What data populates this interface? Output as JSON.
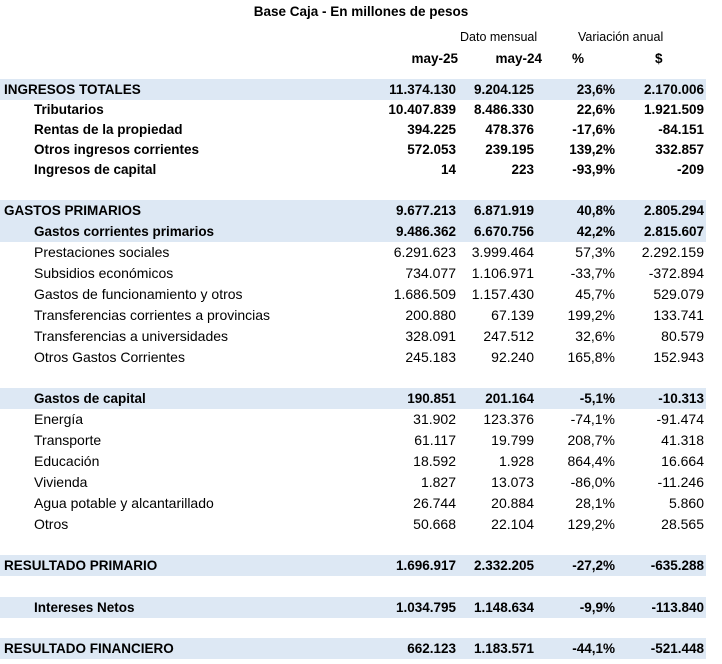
{
  "title": "Base Caja - En millones de pesos",
  "headers": {
    "group_left": "Dato mensual",
    "group_right": "Variación anual",
    "cols": [
      "may-25",
      "may-24",
      "%",
      "$"
    ]
  },
  "rows": [
    {
      "label": "INGRESOS TOTALES",
      "values": [
        "11.374.130",
        "9.204.125",
        "23,6%",
        "2.170.006"
      ]
    },
    {
      "label": "Tributarios",
      "values": [
        "10.407.839",
        "8.486.330",
        "22,6%",
        "1.921.509"
      ]
    },
    {
      "label": "Rentas de la propiedad",
      "values": [
        "394.225",
        "478.376",
        "-17,6%",
        "-84.151"
      ]
    },
    {
      "label": "Otros ingresos corrientes",
      "values": [
        "572.053",
        "239.195",
        "139,2%",
        "332.857"
      ]
    },
    {
      "label": "Ingresos de capital",
      "values": [
        "14",
        "223",
        "-93,9%",
        "-209"
      ]
    },
    {
      "label": "GASTOS PRIMARIOS",
      "values": [
        "9.677.213",
        "6.871.919",
        "40,8%",
        "2.805.294"
      ]
    },
    {
      "label": "Gastos corrientes primarios",
      "values": [
        "9.486.362",
        "6.670.756",
        "42,2%",
        "2.815.607"
      ]
    },
    {
      "label": "Prestaciones sociales",
      "values": [
        "6.291.623",
        "3.999.464",
        "57,3%",
        "2.292.159"
      ]
    },
    {
      "label": "Subsidios económicos",
      "values": [
        "734.077",
        "1.106.971",
        "-33,7%",
        "-372.894"
      ]
    },
    {
      "label": "Gastos de funcionamiento y otros",
      "values": [
        "1.686.509",
        "1.157.430",
        "45,7%",
        "529.079"
      ]
    },
    {
      "label": "Transferencias corrientes a provincias",
      "values": [
        "200.880",
        "67.139",
        "199,2%",
        "133.741"
      ]
    },
    {
      "label": "Transferencias a universidades",
      "values": [
        "328.091",
        "247.512",
        "32,6%",
        "80.579"
      ]
    },
    {
      "label": "Otros Gastos Corrientes",
      "values": [
        "245.183",
        "92.240",
        "165,8%",
        "152.943"
      ]
    },
    {
      "label": "Gastos de capital",
      "values": [
        "190.851",
        "201.164",
        "-5,1%",
        "-10.313"
      ]
    },
    {
      "label": "Energía",
      "values": [
        "31.902",
        "123.376",
        "-74,1%",
        "-91.474"
      ]
    },
    {
      "label": "Transporte",
      "values": [
        "61.117",
        "19.799",
        "208,7%",
        "41.318"
      ]
    },
    {
      "label": "Educación",
      "values": [
        "18.592",
        "1.928",
        "864,4%",
        "16.664"
      ]
    },
    {
      "label": "Vivienda",
      "values": [
        "1.827",
        "13.073",
        "-86,0%",
        "-11.246"
      ]
    },
    {
      "label": "Agua potable y alcantarillado",
      "values": [
        "26.744",
        "20.884",
        "28,1%",
        "5.860"
      ]
    },
    {
      "label": "Otros",
      "values": [
        "50.668",
        "22.104",
        "129,2%",
        "28.565"
      ]
    },
    {
      "label": "RESULTADO PRIMARIO",
      "values": [
        "1.696.917",
        "2.332.205",
        "-27,2%",
        "-635.288"
      ]
    },
    {
      "label": "Intereses Netos",
      "values": [
        "1.034.795",
        "1.148.634",
        "-9,9%",
        "-113.840"
      ]
    },
    {
      "label": "RESULTADO FINANCIERO",
      "values": [
        "662.123",
        "1.183.571",
        "-44,1%",
        "-521.448"
      ]
    }
  ]
}
